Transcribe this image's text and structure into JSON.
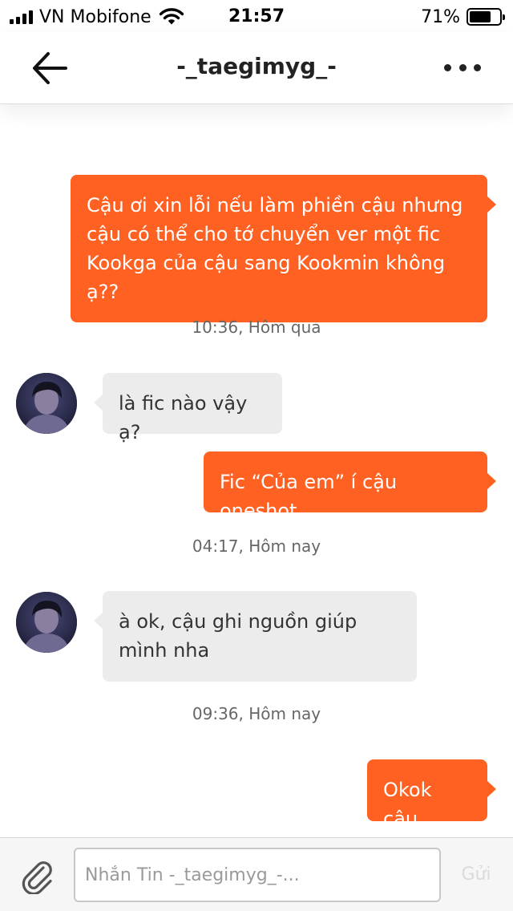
{
  "status_bar": {
    "carrier": "VN Mobifone",
    "time": "21:57",
    "battery_percent_label": "71%",
    "battery_level": 0.71,
    "icons": [
      "signal-icon",
      "wifi-icon",
      "battery-icon"
    ]
  },
  "header": {
    "title": "-_taegimyg_-",
    "back_icon": "back-arrow-icon",
    "more_icon": "more-options-icon"
  },
  "messages": [
    {
      "direction": "outgoing",
      "text": "Cậu ơi xin lỗi nếu làm phiền cậu nhưng cậu có thể cho tớ chuyển ver một fic Kookga của cậu sang Kookmin không ạ??"
    },
    {
      "type": "timestamp",
      "text": "10:36, Hôm qua"
    },
    {
      "direction": "incoming",
      "text": "là fic nào vậy ạ?"
    },
    {
      "direction": "outgoing",
      "text": "Fic “Của em” í cậu oneshot"
    },
    {
      "type": "timestamp",
      "text": "04:17, Hôm nay"
    },
    {
      "direction": "incoming",
      "text": "à ok, cậu ghi nguồn giúp mình nha"
    },
    {
      "type": "timestamp",
      "text": "09:36, Hôm nay"
    },
    {
      "direction": "outgoing",
      "text": "Okok cậu"
    }
  ],
  "composer": {
    "placeholder": "Nhắn Tin -_taegimyg_-...",
    "value": "",
    "send_label": "Gửi",
    "attach_icon": "paperclip-icon"
  },
  "colors": {
    "outgoing_bubble": "#ff6122",
    "incoming_bubble": "#ececec",
    "send_disabled": "#dadada"
  }
}
